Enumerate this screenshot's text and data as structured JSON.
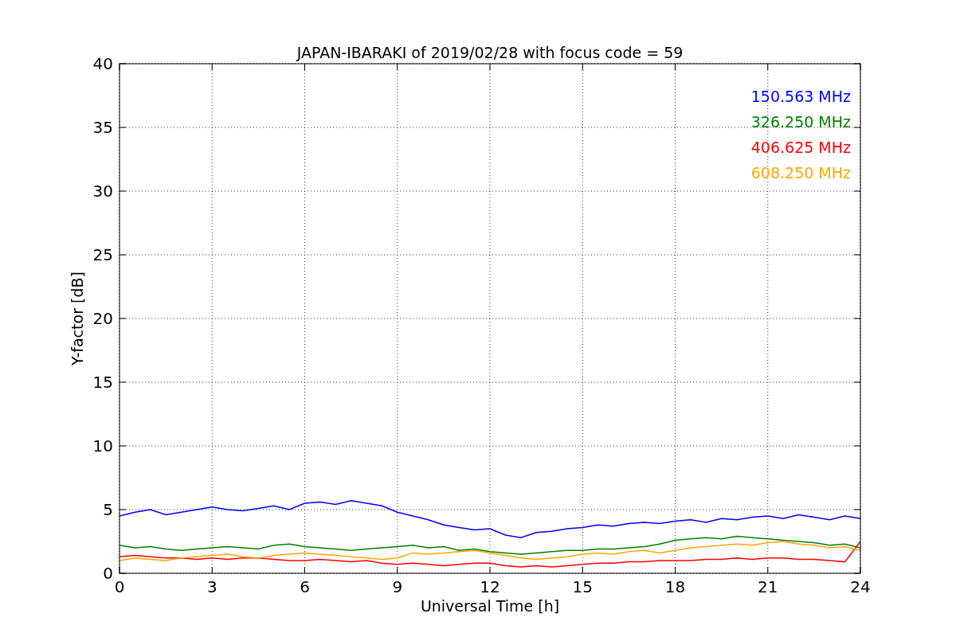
{
  "chart_data": {
    "type": "line",
    "title": "JAPAN-IBARAKI of 2019/02/28 with focus code = 59",
    "xlabel": "Universal Time [h]",
    "ylabel": "Y-factor [dB]",
    "x": [
      0,
      0.5,
      1,
      1.5,
      2,
      2.5,
      3,
      3.5,
      4,
      4.5,
      5,
      5.5,
      6,
      6.5,
      7,
      7.5,
      8,
      8.5,
      9,
      9.5,
      10,
      10.5,
      11,
      11.5,
      12,
      12.5,
      13,
      13.5,
      14,
      14.5,
      15,
      15.5,
      16,
      16.5,
      17,
      17.5,
      18,
      18.5,
      19,
      19.5,
      20,
      20.5,
      21,
      21.5,
      22,
      22.5,
      23,
      23.5,
      24
    ],
    "series": [
      {
        "name": "150.563 MHz",
        "color": "#0000ff",
        "values": [
          4.5,
          4.8,
          5,
          4.6,
          4.8,
          5,
          5.2,
          5,
          4.9,
          5.1,
          5.3,
          5,
          5.5,
          5.6,
          5.4,
          5.7,
          5.5,
          5.3,
          4.8,
          4.5,
          4.2,
          3.8,
          3.6,
          3.4,
          3.5,
          3.0,
          2.8,
          3.2,
          3.3,
          3.5,
          3.6,
          3.8,
          3.7,
          3.9,
          4.0,
          3.9,
          4.1,
          4.2,
          4.0,
          4.3,
          4.2,
          4.4,
          4.5,
          4.3,
          4.6,
          4.4,
          4.2,
          4.5,
          4.3
        ]
      },
      {
        "name": "326.250 MHz",
        "color": "#008000",
        "values": [
          2.2,
          2.0,
          2.1,
          1.9,
          1.8,
          1.9,
          2.0,
          2.1,
          2.0,
          1.9,
          2.2,
          2.3,
          2.1,
          2.0,
          1.9,
          1.8,
          1.9,
          2.0,
          2.1,
          2.2,
          2.0,
          2.1,
          1.8,
          1.9,
          1.7,
          1.6,
          1.5,
          1.6,
          1.7,
          1.8,
          1.8,
          1.9,
          1.9,
          2.0,
          2.1,
          2.3,
          2.6,
          2.7,
          2.8,
          2.7,
          2.9,
          2.8,
          2.7,
          2.6,
          2.5,
          2.4,
          2.2,
          2.3,
          2.0
        ]
      },
      {
        "name": "406.625 MHz",
        "color": "#ff0000",
        "values": [
          1.3,
          1.4,
          1.3,
          1.2,
          1.2,
          1.1,
          1.2,
          1.1,
          1.2,
          1.2,
          1.1,
          1.0,
          1.0,
          1.1,
          1.0,
          0.9,
          1.0,
          0.8,
          0.7,
          0.8,
          0.7,
          0.6,
          0.7,
          0.8,
          0.8,
          0.6,
          0.5,
          0.6,
          0.5,
          0.6,
          0.7,
          0.8,
          0.8,
          0.9,
          0.9,
          1.0,
          1.0,
          1.0,
          1.1,
          1.1,
          1.2,
          1.1,
          1.2,
          1.2,
          1.1,
          1.1,
          1.0,
          0.9,
          2.5
        ]
      },
      {
        "name": "608.250 MHz",
        "color": "#ffa500",
        "values": [
          1.0,
          1.2,
          1.1,
          1.0,
          1.2,
          1.3,
          1.4,
          1.5,
          1.3,
          1.2,
          1.4,
          1.5,
          1.6,
          1.5,
          1.4,
          1.3,
          1.2,
          1.1,
          1.2,
          1.6,
          1.5,
          1.6,
          1.7,
          1.8,
          1.6,
          1.4,
          1.2,
          1.1,
          1.2,
          1.3,
          1.5,
          1.6,
          1.5,
          1.7,
          1.8,
          1.6,
          1.8,
          2.0,
          2.1,
          2.2,
          2.3,
          2.2,
          2.4,
          2.5,
          2.3,
          2.2,
          2.0,
          2.1,
          1.8
        ]
      }
    ],
    "grid": true,
    "xlim": [
      0,
      24
    ],
    "ylim": [
      0,
      40
    ],
    "xticks": [
      0,
      3,
      6,
      9,
      12,
      15,
      18,
      21,
      24
    ],
    "yticks": [
      0,
      5,
      10,
      15,
      20,
      25,
      30,
      35,
      40
    ]
  }
}
